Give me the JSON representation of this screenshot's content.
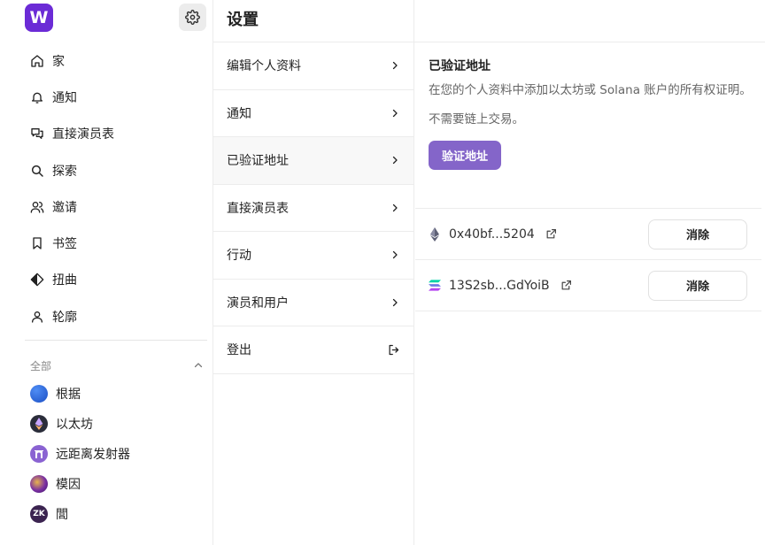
{
  "app": {
    "logo_letter": "W",
    "page_title": "设置"
  },
  "sidebar": {
    "nav": [
      {
        "label": "家",
        "icon": "home-icon"
      },
      {
        "label": "通知",
        "icon": "bell-icon"
      },
      {
        "label": "直接演员表",
        "icon": "chat-bubbles-icon"
      },
      {
        "label": "探索",
        "icon": "search-icon"
      },
      {
        "label": "邀请",
        "icon": "users-icon"
      },
      {
        "label": "书签",
        "icon": "bookmark-icon"
      },
      {
        "label": "扭曲",
        "icon": "diamond-icon"
      },
      {
        "label": "轮廓",
        "icon": "user-icon"
      }
    ],
    "section_label": "全部",
    "channels": [
      {
        "label": "根据",
        "icon": "base-icon",
        "color": "#1b5ed8"
      },
      {
        "label": "以太坊",
        "icon": "ethereum-icon",
        "color": "#2b2d3a"
      },
      {
        "label": "远距离发射器",
        "icon": "farcaster-icon",
        "color": "#8a63d2"
      },
      {
        "label": "模因",
        "icon": "memes-icon",
        "color": "#5a2a86"
      },
      {
        "label": "閭",
        "icon": "zk-icon",
        "color": "#3b2350",
        "badge": "ZK"
      }
    ]
  },
  "settings_menu": [
    {
      "label": "编辑个人资料",
      "icon": "chevron-right-icon",
      "active": false
    },
    {
      "label": "通知",
      "icon": "chevron-right-icon",
      "active": false
    },
    {
      "label": "已验证地址",
      "icon": "chevron-right-icon",
      "active": true
    },
    {
      "label": "直接演员表",
      "icon": "chevron-right-icon",
      "active": false
    },
    {
      "label": "行动",
      "icon": "chevron-right-icon",
      "active": false
    },
    {
      "label": "演员和用户",
      "icon": "chevron-right-icon",
      "active": false
    },
    {
      "label": "登出",
      "icon": "logout-icon",
      "active": false
    }
  ],
  "verified": {
    "title": "已验证地址",
    "description": "在您的个人资料中添加以太坊或 Solana 账户的所有权证明。",
    "note": "不需要链上交易。",
    "verify_button": "验证地址",
    "addresses": [
      {
        "address": "0x40bf...5204",
        "chain_icon": "ethereum-icon",
        "remove_label": "消除"
      },
      {
        "address": "13S2sb...GdYoiB",
        "chain_icon": "solana-icon",
        "remove_label": "消除"
      }
    ]
  },
  "colors": {
    "brand": "#6b2bd6",
    "verify_button": "#8465c9",
    "border": "#ececec"
  }
}
